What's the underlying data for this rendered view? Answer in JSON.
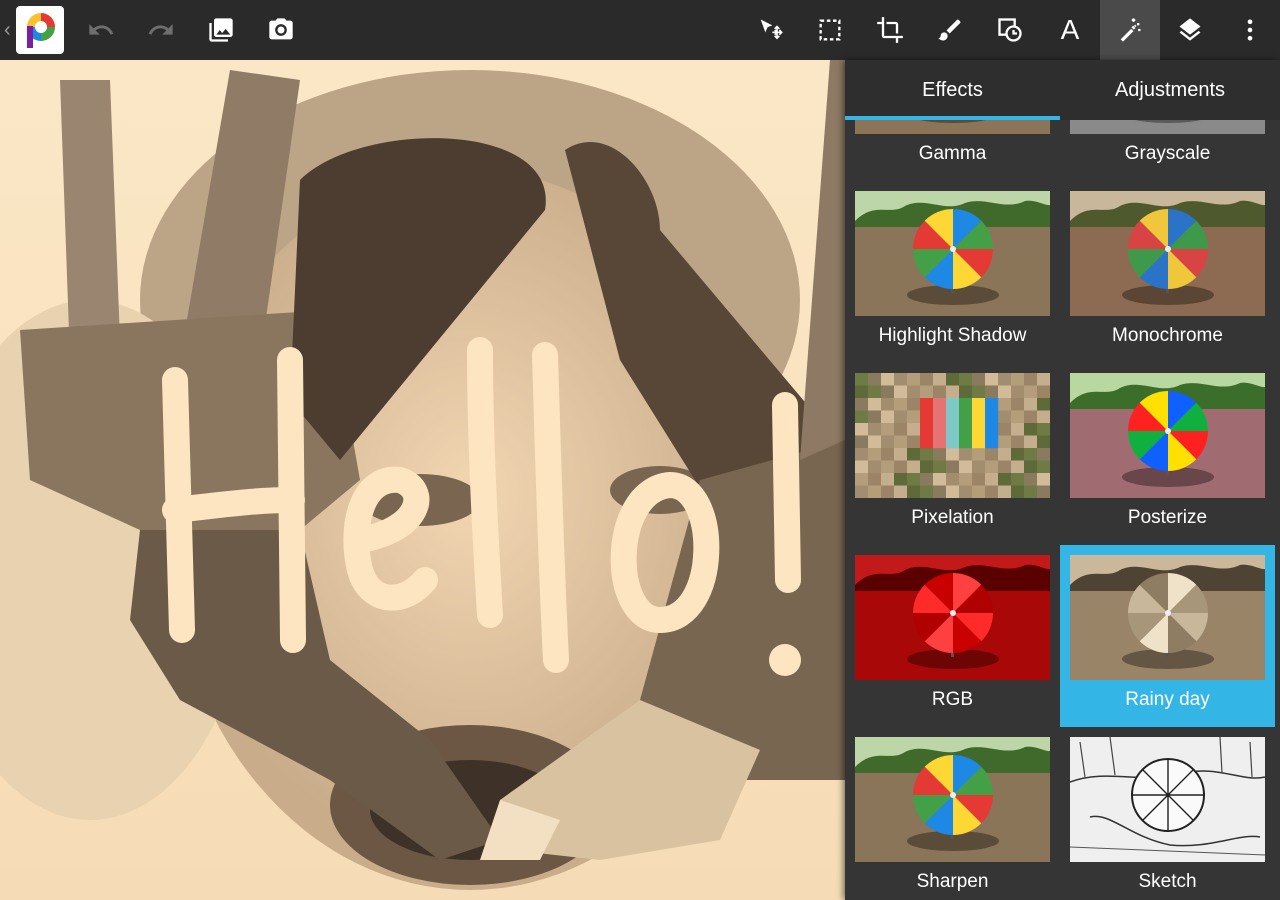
{
  "toolbar": {
    "back_icon": "chevron-left",
    "logo": "app-logo",
    "left_buttons": [
      "undo-icon",
      "redo-icon",
      "image-gallery-icon",
      "camera-icon"
    ],
    "right_buttons": [
      "move-select-icon",
      "marquee-select-icon",
      "crop-icon",
      "brush-icon",
      "shapes-icon",
      "text-icon",
      "magic-wand-icon",
      "layers-icon",
      "more-vert-icon"
    ],
    "text_tool_label": "A",
    "active_tool": "magic-wand-icon"
  },
  "canvas": {
    "overlay_text": "Hello!",
    "overlay_color": "#fde5c2"
  },
  "panel": {
    "tabs": [
      {
        "label": "Effects",
        "active": true
      },
      {
        "label": "Adjustments",
        "active": false
      }
    ],
    "accent": "#33b5e5",
    "effects": [
      {
        "label": "Gamma",
        "style": "color",
        "selected": false
      },
      {
        "label": "Grayscale",
        "style": "gray",
        "selected": false
      },
      {
        "label": "Highlight Shadow",
        "style": "color",
        "selected": false
      },
      {
        "label": "Monochrome",
        "style": "warm",
        "selected": false
      },
      {
        "label": "Pixelation",
        "style": "pixel",
        "selected": false
      },
      {
        "label": "Posterize",
        "style": "poster",
        "selected": false
      },
      {
        "label": "RGB",
        "style": "red",
        "selected": false
      },
      {
        "label": "Rainy day",
        "style": "sepia",
        "selected": true
      },
      {
        "label": "Sharpen",
        "style": "color",
        "selected": false
      },
      {
        "label": "Sketch",
        "style": "sketch",
        "selected": false
      }
    ]
  }
}
